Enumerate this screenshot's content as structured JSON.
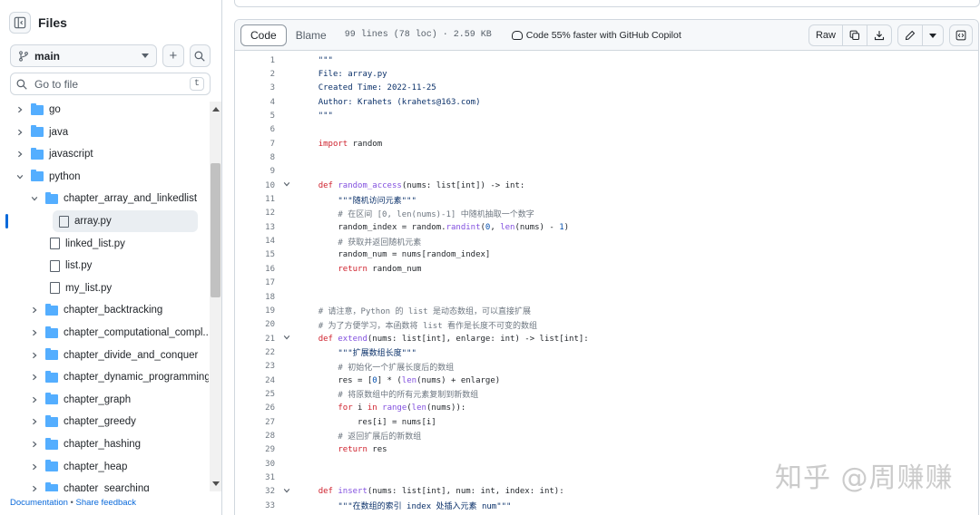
{
  "sidebar": {
    "title": "Files",
    "branch": "main",
    "goto_placeholder": "Go to file",
    "goto_shortcut": "t",
    "tree": [
      {
        "label": "go",
        "kind": "folder",
        "depth": 1,
        "expanded": false
      },
      {
        "label": "java",
        "kind": "folder",
        "depth": 1,
        "expanded": false
      },
      {
        "label": "javascript",
        "kind": "folder",
        "depth": 1,
        "expanded": false
      },
      {
        "label": "python",
        "kind": "folder",
        "depth": 1,
        "expanded": true
      },
      {
        "label": "chapter_array_and_linkedlist",
        "kind": "folder",
        "depth": 2,
        "expanded": true
      },
      {
        "label": "array.py",
        "kind": "file",
        "depth": 3,
        "active": true
      },
      {
        "label": "linked_list.py",
        "kind": "file",
        "depth": 3
      },
      {
        "label": "list.py",
        "kind": "file",
        "depth": 3
      },
      {
        "label": "my_list.py",
        "kind": "file",
        "depth": 3
      },
      {
        "label": "chapter_backtracking",
        "kind": "folder",
        "depth": 2,
        "expanded": false
      },
      {
        "label": "chapter_computational_compl...",
        "kind": "folder",
        "depth": 2,
        "expanded": false
      },
      {
        "label": "chapter_divide_and_conquer",
        "kind": "folder",
        "depth": 2,
        "expanded": false
      },
      {
        "label": "chapter_dynamic_programming",
        "kind": "folder",
        "depth": 2,
        "expanded": false
      },
      {
        "label": "chapter_graph",
        "kind": "folder",
        "depth": 2,
        "expanded": false
      },
      {
        "label": "chapter_greedy",
        "kind": "folder",
        "depth": 2,
        "expanded": false
      },
      {
        "label": "chapter_hashing",
        "kind": "folder",
        "depth": 2,
        "expanded": false
      },
      {
        "label": "chapter_heap",
        "kind": "folder",
        "depth": 2,
        "expanded": false
      },
      {
        "label": "chapter_searching",
        "kind": "folder",
        "depth": 2,
        "expanded": false
      }
    ],
    "footer": {
      "docs": "Documentation",
      "sep": "•",
      "feedback": "Share feedback"
    }
  },
  "toolbar": {
    "code_tab": "Code",
    "blame_tab": "Blame",
    "meta": "99 lines (78 loc) · 2.59 KB",
    "copilot": "Code 55% faster with GitHub Copilot",
    "raw": "Raw"
  },
  "code_lines": [
    {
      "n": "1",
      "fold": "",
      "tokens": [
        [
          "    ",
          ""
        ],
        [
          "\"\"\"",
          "str"
        ]
      ]
    },
    {
      "n": "2",
      "fold": "",
      "tokens": [
        [
          "    ",
          ""
        ],
        [
          "File: array.py",
          "str"
        ]
      ]
    },
    {
      "n": "3",
      "fold": "",
      "tokens": [
        [
          "    ",
          ""
        ],
        [
          "Created Time: 2022-11-25",
          "str"
        ]
      ]
    },
    {
      "n": "4",
      "fold": "",
      "tokens": [
        [
          "    ",
          ""
        ],
        [
          "Author: Krahets (krahets@163.com)",
          "str"
        ]
      ]
    },
    {
      "n": "5",
      "fold": "",
      "tokens": [
        [
          "    ",
          ""
        ],
        [
          "\"\"\"",
          "str"
        ]
      ]
    },
    {
      "n": "6",
      "fold": "",
      "tokens": []
    },
    {
      "n": "7",
      "fold": "",
      "tokens": [
        [
          "    ",
          ""
        ],
        [
          "import",
          "kw"
        ],
        [
          " random",
          ""
        ]
      ]
    },
    {
      "n": "8",
      "fold": "",
      "tokens": []
    },
    {
      "n": "9",
      "fold": "",
      "tokens": []
    },
    {
      "n": "10",
      "fold": "v",
      "tokens": [
        [
          "    ",
          ""
        ],
        [
          "def",
          "kw"
        ],
        [
          " ",
          ""
        ],
        [
          "random_access",
          "fn"
        ],
        [
          "(nums: list[int]) -> int:",
          ""
        ]
      ]
    },
    {
      "n": "11",
      "fold": "",
      "tokens": [
        [
          "        ",
          ""
        ],
        [
          "\"\"\"随机访问元素\"\"\"",
          "str"
        ]
      ]
    },
    {
      "n": "12",
      "fold": "",
      "tokens": [
        [
          "        ",
          ""
        ],
        [
          "# 在区间 [0, len(nums)-1] 中随机抽取一个数字",
          "cm"
        ]
      ]
    },
    {
      "n": "13",
      "fold": "",
      "tokens": [
        [
          "        random_index = random.",
          ""
        ],
        [
          "randint",
          "fn"
        ],
        [
          "(",
          ""
        ],
        [
          "0",
          "num"
        ],
        [
          ", ",
          ""
        ],
        [
          "len",
          "fn"
        ],
        [
          "(nums) - ",
          ""
        ],
        [
          "1",
          "num"
        ],
        [
          ")",
          ""
        ]
      ]
    },
    {
      "n": "14",
      "fold": "",
      "tokens": [
        [
          "        ",
          ""
        ],
        [
          "# 获取并返回随机元素",
          "cm"
        ]
      ]
    },
    {
      "n": "15",
      "fold": "",
      "tokens": [
        [
          "        random_num = nums[random_index]",
          ""
        ]
      ]
    },
    {
      "n": "16",
      "fold": "",
      "tokens": [
        [
          "        ",
          ""
        ],
        [
          "return",
          "kw"
        ],
        [
          " random_num",
          ""
        ]
      ]
    },
    {
      "n": "17",
      "fold": "",
      "tokens": []
    },
    {
      "n": "18",
      "fold": "",
      "tokens": []
    },
    {
      "n": "19",
      "fold": "",
      "tokens": [
        [
          "    ",
          ""
        ],
        [
          "# 请注意，Python 的 list 是动态数组，可以直接扩展",
          "cm"
        ]
      ]
    },
    {
      "n": "20",
      "fold": "",
      "tokens": [
        [
          "    ",
          ""
        ],
        [
          "# 为了方便学习，本函数将 list 看作是长度不可变的数组",
          "cm"
        ]
      ]
    },
    {
      "n": "21",
      "fold": "v",
      "tokens": [
        [
          "    ",
          ""
        ],
        [
          "def",
          "kw"
        ],
        [
          " ",
          ""
        ],
        [
          "extend",
          "fn"
        ],
        [
          "(nums: list[int], enlarge: int) -> list[int]:",
          ""
        ]
      ]
    },
    {
      "n": "22",
      "fold": "",
      "tokens": [
        [
          "        ",
          ""
        ],
        [
          "\"\"\"扩展数组长度\"\"\"",
          "str"
        ]
      ]
    },
    {
      "n": "23",
      "fold": "",
      "tokens": [
        [
          "        ",
          ""
        ],
        [
          "# 初始化一个扩展长度后的数组",
          "cm"
        ]
      ]
    },
    {
      "n": "24",
      "fold": "",
      "tokens": [
        [
          "        res = [",
          ""
        ],
        [
          "0",
          "num"
        ],
        [
          "] * (",
          ""
        ],
        [
          "len",
          "fn"
        ],
        [
          "(nums) + enlarge)",
          ""
        ]
      ]
    },
    {
      "n": "25",
      "fold": "",
      "tokens": [
        [
          "        ",
          ""
        ],
        [
          "# 将原数组中的所有元素复制到新数组",
          "cm"
        ]
      ]
    },
    {
      "n": "26",
      "fold": "",
      "tokens": [
        [
          "        ",
          ""
        ],
        [
          "for",
          "kw"
        ],
        [
          " i ",
          ""
        ],
        [
          "in",
          "kw"
        ],
        [
          " ",
          ""
        ],
        [
          "range",
          "fn"
        ],
        [
          "(",
          ""
        ],
        [
          "len",
          "fn"
        ],
        [
          "(nums)):",
          ""
        ]
      ]
    },
    {
      "n": "27",
      "fold": "",
      "tokens": [
        [
          "            res[i] = nums[i]",
          ""
        ]
      ]
    },
    {
      "n": "28",
      "fold": "",
      "tokens": [
        [
          "        ",
          ""
        ],
        [
          "# 返回扩展后的新数组",
          "cm"
        ]
      ]
    },
    {
      "n": "29",
      "fold": "",
      "tokens": [
        [
          "        ",
          ""
        ],
        [
          "return",
          "kw"
        ],
        [
          " res",
          ""
        ]
      ]
    },
    {
      "n": "30",
      "fold": "",
      "tokens": []
    },
    {
      "n": "31",
      "fold": "",
      "tokens": []
    },
    {
      "n": "32",
      "fold": "v",
      "tokens": [
        [
          "    ",
          ""
        ],
        [
          "def",
          "kw"
        ],
        [
          " ",
          ""
        ],
        [
          "insert",
          "fn"
        ],
        [
          "(nums: list[int], num: int, index: int):",
          ""
        ]
      ]
    },
    {
      "n": "33",
      "fold": "",
      "tokens": [
        [
          "        ",
          ""
        ],
        [
          "\"\"\"在数组的索引 index 处插入元素 num\"\"\"",
          "str"
        ]
      ]
    }
  ],
  "watermark": "知乎 @周赚赚"
}
